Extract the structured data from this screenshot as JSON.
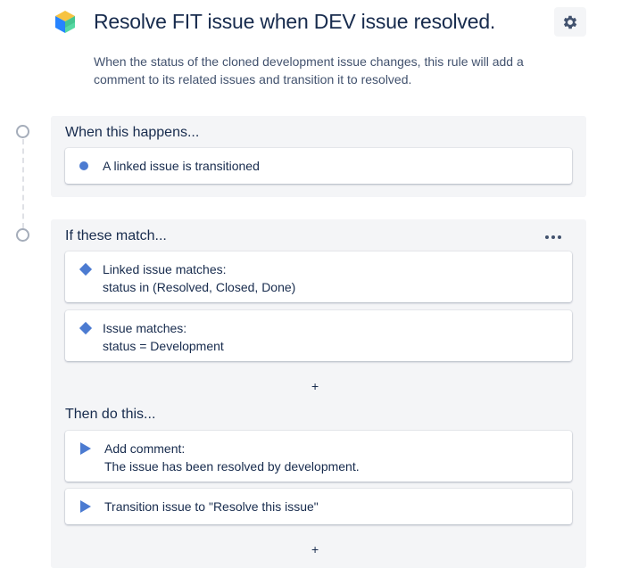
{
  "header": {
    "title": "Resolve FIT issue when DEV issue resolved.",
    "description": "When the status of the cloned development issue changes, this rule will add a comment to its related issues and transition it to resolved.",
    "settings_icon": "gear-icon",
    "logo_icon": "automation-cube-icon"
  },
  "trigger_section": {
    "title": "When this happens...",
    "card": {
      "icon": "trigger-dot-icon",
      "text": "A linked issue is transitioned"
    }
  },
  "condition_section": {
    "title": "If these match...",
    "more_icon": "more-icon",
    "conditions": [
      {
        "icon": "condition-diamond-icon",
        "line1": "Linked issue matches:",
        "line2": "status in (Resolved, Closed, Done)"
      },
      {
        "icon": "condition-diamond-icon",
        "line1": "Issue matches:",
        "line2": "status = Development"
      }
    ],
    "add_label": "+"
  },
  "action_section": {
    "title": "Then do this...",
    "actions": [
      {
        "icon": "action-play-icon",
        "line1": "Add comment:",
        "line2": "The issue has been resolved by development."
      },
      {
        "icon": "action-play-icon",
        "line1": "Transition issue to \"Resolve this issue\""
      }
    ],
    "add_label": "+"
  },
  "colors": {
    "accent": "#4c7bd1",
    "text": "#172b4d",
    "subtle_text": "#42526e",
    "section_bg": "#f4f5f7"
  }
}
